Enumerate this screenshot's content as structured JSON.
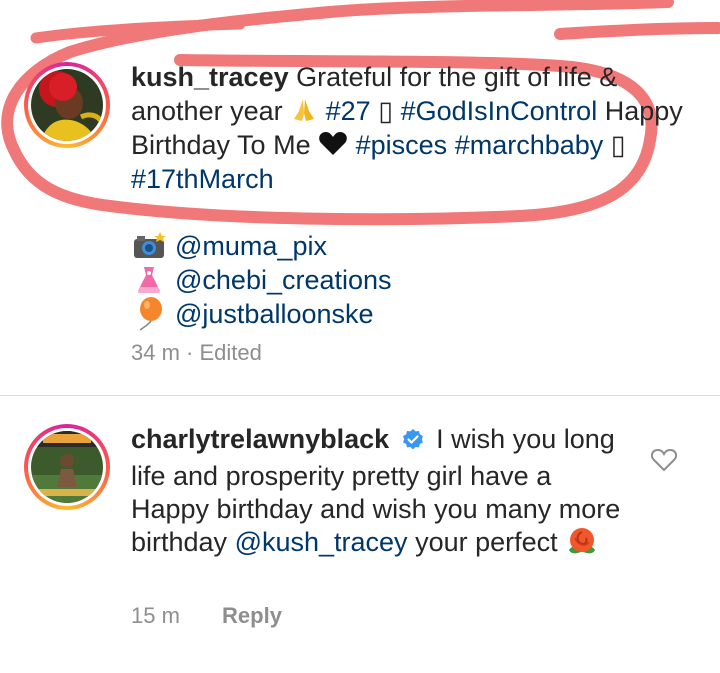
{
  "comment1": {
    "username": "kush_tracey",
    "text_a": "Grateful for the gift of life & another year",
    "hashtag_27": "#27",
    "glyph_box": "▯",
    "hashtag_god": "#GodIsInControl",
    "text_b": "Happy Birthday To Me",
    "hashtag_pisces": "#pisces",
    "hashtag_marchbaby": "#marchbaby",
    "hashtag_17th": "#17thMarch",
    "credits": [
      {
        "icon": "camera-icon",
        "handle": "@muma_pix"
      },
      {
        "icon": "dress-icon",
        "handle": "@chebi_creations"
      },
      {
        "icon": "balloon-icon",
        "handle": "@justballoonske"
      }
    ],
    "time": "34 m",
    "separator": "·",
    "edited": "Edited"
  },
  "comment2": {
    "username": "charlytrelawnyblack",
    "text_a": "I wish you long life and prosperity pretty girl have a Happy birthday and wish you many more birthday",
    "mention": "@kush_tracey",
    "text_b": "your perfect",
    "time": "15 m",
    "reply_label": "Reply"
  },
  "colors": {
    "text": "#262626",
    "link": "#00376b",
    "meta": "#8e8e8e",
    "verified": "#3897f0",
    "scribble": "#f07878"
  }
}
